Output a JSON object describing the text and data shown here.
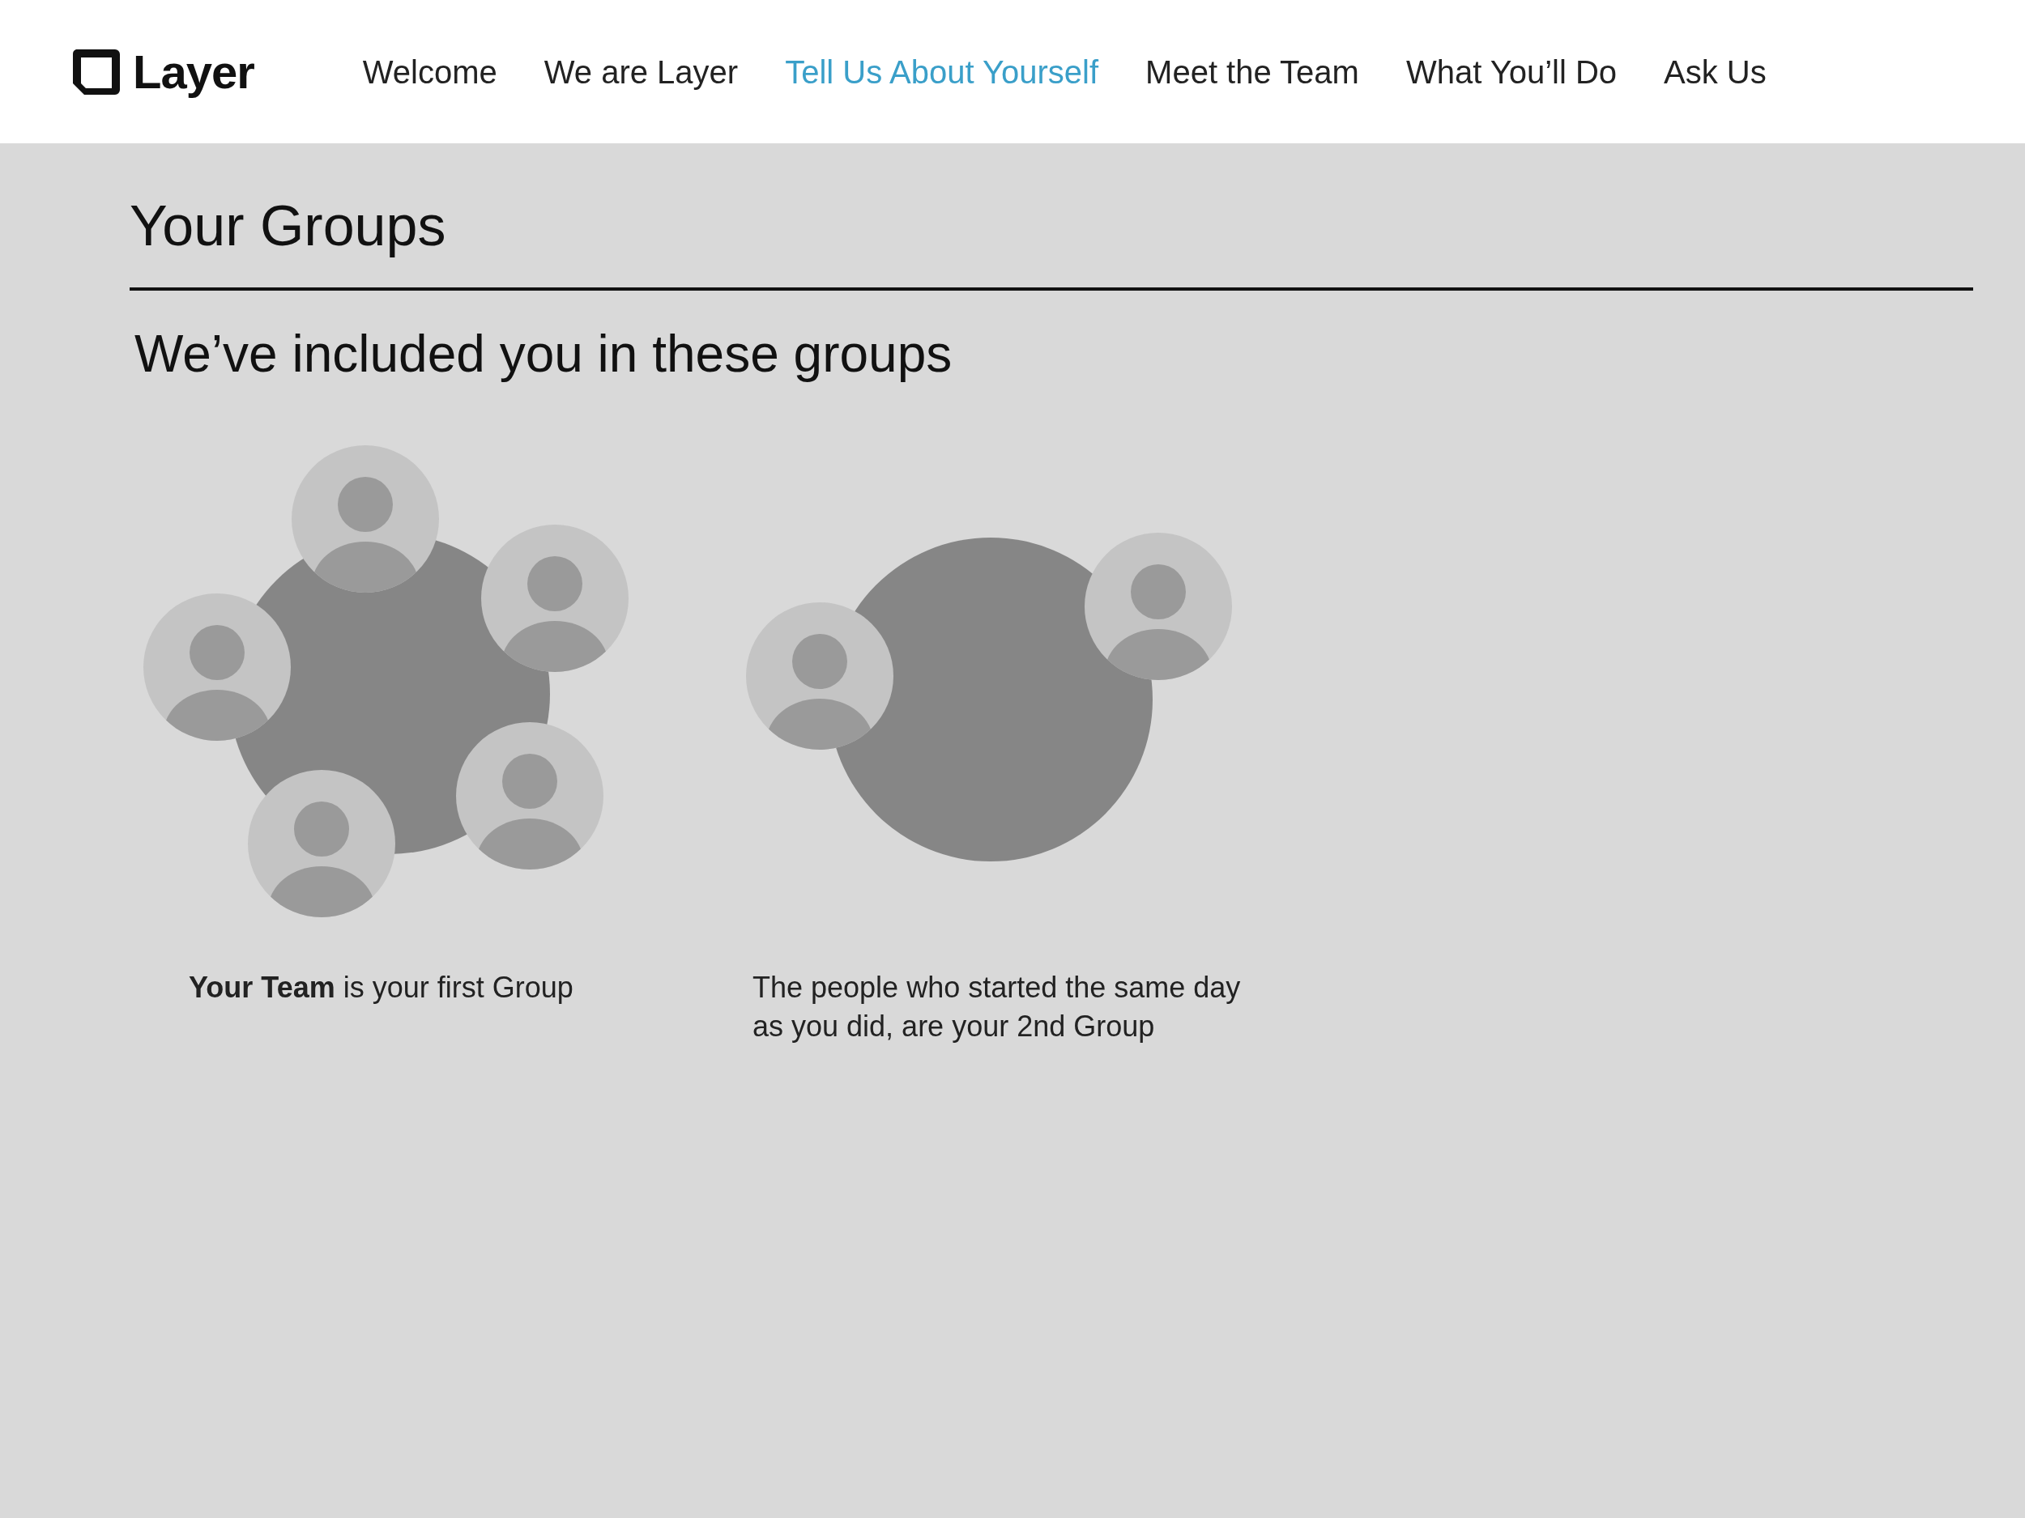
{
  "header": {
    "logo_text": "Layer"
  },
  "nav": [
    {
      "label": "Welcome",
      "selected": false
    },
    {
      "label": "We are Layer",
      "selected": false
    },
    {
      "label": "Tell Us About Yourself",
      "selected": true
    },
    {
      "label": "Meet the Team",
      "selected": false
    },
    {
      "label": "What You’ll Do",
      "selected": false
    },
    {
      "label": "Ask Us",
      "selected": false
    }
  ],
  "page": {
    "title": "Your Groups",
    "subtitle": "We’ve included you in these groups"
  },
  "groups": [
    {
      "kind": "team",
      "caption": "**Your Team** is your first Group"
    },
    {
      "kind": "start-date",
      "caption": "The people who started the same day as you did, are your 2nd Group"
    }
  ]
}
